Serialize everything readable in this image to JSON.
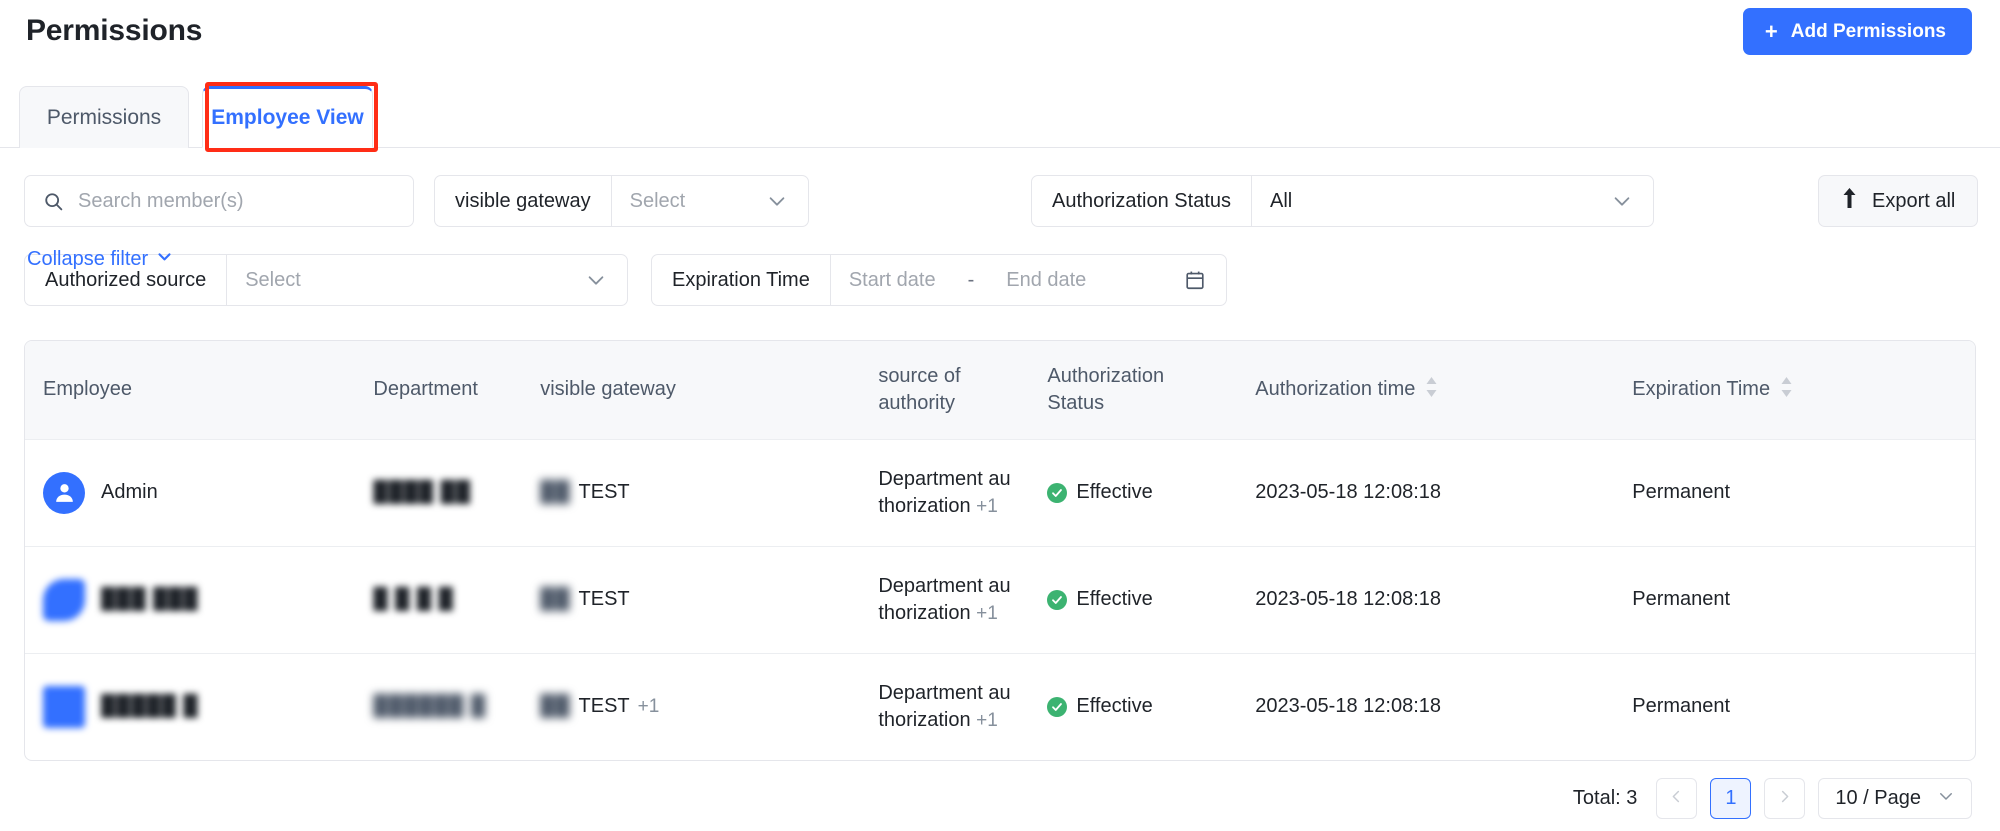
{
  "header": {
    "title": "Permissions",
    "add_button": {
      "label": "Add Permissions",
      "icon": "plus-icon",
      "color": "#3370ff"
    }
  },
  "tabs": [
    {
      "label": "Permissions",
      "active": false
    },
    {
      "label": "Employee View",
      "active": true
    }
  ],
  "highlight": {
    "target": "Employee View",
    "color": "#ff2d16"
  },
  "filters": {
    "search": {
      "placeholder": "Search member(s)",
      "value": "",
      "icon": "search-icon"
    },
    "gateway": {
      "label": "visible gateway",
      "value": "",
      "placeholder": "Select",
      "icon": "chevron-down-icon"
    },
    "auth_status": {
      "label": "Authorization Status",
      "value": "All",
      "icon": "chevron-down-icon"
    },
    "auth_source": {
      "label": "Authorized source",
      "value": "",
      "placeholder": "Select",
      "icon": "chevron-down-icon"
    },
    "expiration": {
      "label": "Expiration Time",
      "start_placeholder": "Start date",
      "end_placeholder": "End date",
      "separator": "-",
      "icon": "calendar-icon"
    },
    "collapse": {
      "label": "Collapse filter",
      "icon": "chevron-down-icon"
    },
    "export": {
      "label": "Export all",
      "icon": "upload-arrow-icon"
    }
  },
  "table": {
    "columns": [
      {
        "label": "Employee",
        "sortable": false
      },
      {
        "label": "Department",
        "sortable": false
      },
      {
        "label": "visible gateway",
        "sortable": false
      },
      {
        "label": "source of authority",
        "line1": "source of",
        "line2": "authority",
        "sortable": false
      },
      {
        "label": "Authorization Status",
        "line1": "Authorization",
        "line2": "Status",
        "sortable": false
      },
      {
        "label": "Authorization time",
        "sortable": true
      },
      {
        "label": "Expiration Time",
        "sortable": true
      }
    ],
    "rows": [
      {
        "employee": "Admin",
        "employee_redacted": false,
        "avatar": "user-avatar-icon",
        "department": "████ ██",
        "department_redacted": true,
        "gateway_prefix": "██",
        "gateway_prefix_redacted": true,
        "gateway": "TEST",
        "gateway_extra": "",
        "source": "Department au thorization",
        "source_line1": "Department au",
        "source_line2": "thorization",
        "source_extra": "+1",
        "status": "Effective",
        "status_color": "#3cb371",
        "auth_time": "2023-05-18 12:08:18",
        "expiration": "Permanent"
      },
      {
        "employee": "███ ███",
        "employee_redacted": true,
        "avatar": "user-avatar-icon",
        "department": "█ █ █ █",
        "department_redacted": true,
        "gateway_prefix": "██",
        "gateway_prefix_redacted": true,
        "gateway": "TEST",
        "gateway_extra": "",
        "source": "Department au thorization",
        "source_line1": "Department au",
        "source_line2": "thorization",
        "source_extra": "+1",
        "status": "Effective",
        "status_color": "#3cb371",
        "auth_time": "2023-05-18 12:08:18",
        "expiration": "Permanent"
      },
      {
        "employee": "█████ █",
        "employee_redacted": true,
        "avatar": "user-avatar-icon",
        "department": "██████ █",
        "department_redacted": true,
        "gateway_prefix": "██",
        "gateway_prefix_redacted": true,
        "gateway": "TEST",
        "gateway_extra": "+1",
        "source": "Department au thorization",
        "source_line1": "Department au",
        "source_line2": "thorization",
        "source_extra": "+1",
        "status": "Effective",
        "status_color": "#3cb371",
        "auth_time": "2023-05-18 12:08:18",
        "expiration": "Permanent"
      }
    ]
  },
  "pagination": {
    "total_label": "Total: 3",
    "prev_icon": "chevron-left-icon",
    "next_icon": "chevron-right-icon",
    "current_page": "1",
    "page_size": "10 / Page",
    "page_size_icon": "chevron-down-icon"
  }
}
